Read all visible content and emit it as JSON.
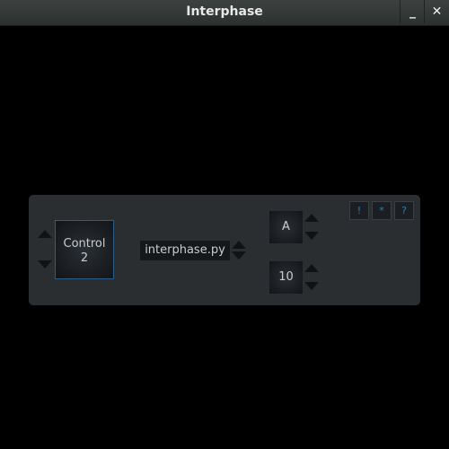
{
  "window": {
    "title": "Interphase",
    "minimize": "_",
    "close": "✕"
  },
  "controls": {
    "control_label": "Control",
    "control_value": "2",
    "file": "interphase.py",
    "letter": "A",
    "number": "10"
  },
  "buttons": {
    "warn": "!",
    "star": "*",
    "help": "?"
  }
}
